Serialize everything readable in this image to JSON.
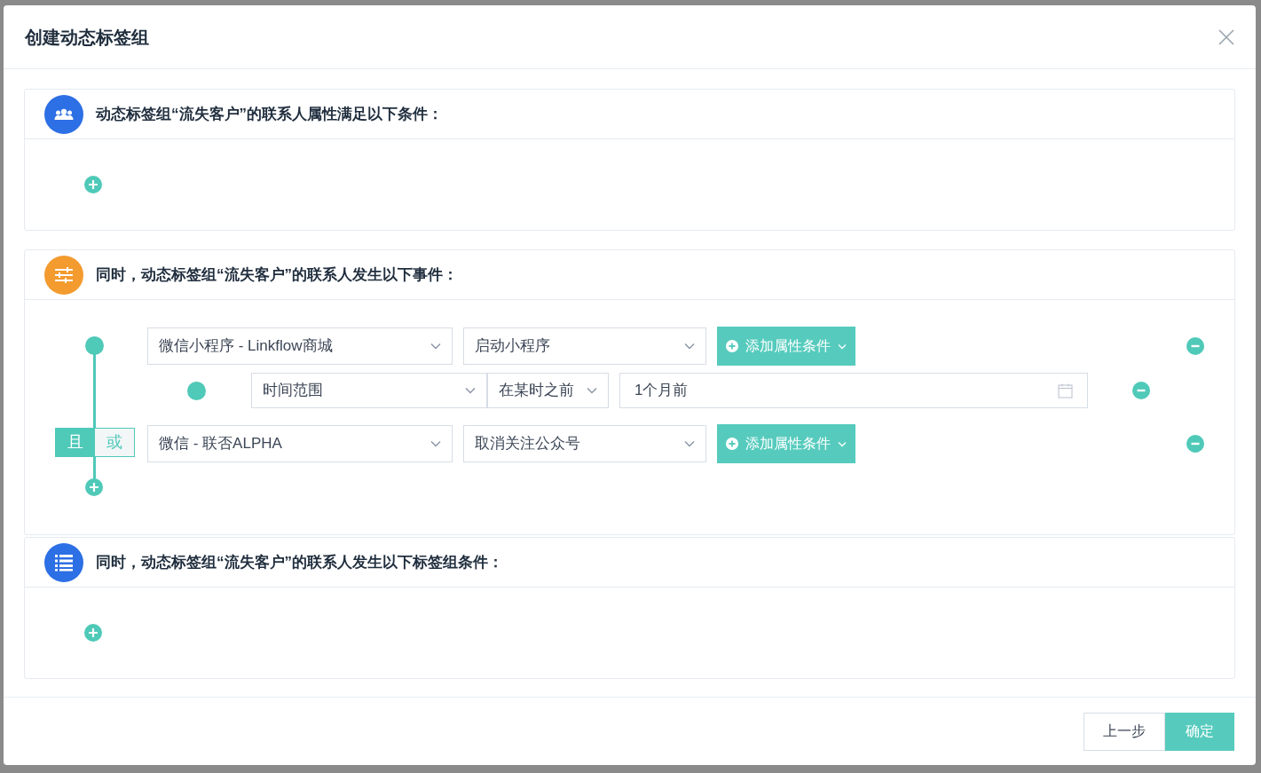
{
  "dialog": {
    "title": "创建动态标签组"
  },
  "sections": [
    {
      "kind": "attributes",
      "color": "#2d6fe4",
      "title": "动态标签组“流失客户”的联系人属性满足以下条件："
    },
    {
      "kind": "events",
      "color": "#f39b2e",
      "title": "同时，动态标签组“流失客户”的联系人发生以下事件："
    },
    {
      "kind": "tags",
      "color": "#2d6fe4",
      "title": "同时，动态标签组“流失客户”的联系人发生以下标签组条件："
    }
  ],
  "logic_toggle": [
    {
      "label": "且",
      "selected": true
    },
    {
      "label": "或",
      "selected": false
    }
  ],
  "events": [
    {
      "source": "微信小程序 - Linkflow商城",
      "action": "启动小程序",
      "add_button": "添加属性条件",
      "conditions": [
        {
          "field": "时间范围",
          "operator": "在某时之前",
          "value": "1个月前"
        }
      ]
    },
    {
      "source": "微信 - 联否ALPHA",
      "action": "取消关注公众号",
      "add_button": "添加属性条件"
    }
  ],
  "footer_buttons": [
    {
      "kind": "secondary",
      "label": "上一步"
    },
    {
      "kind": "primary",
      "label": "确定"
    }
  ]
}
